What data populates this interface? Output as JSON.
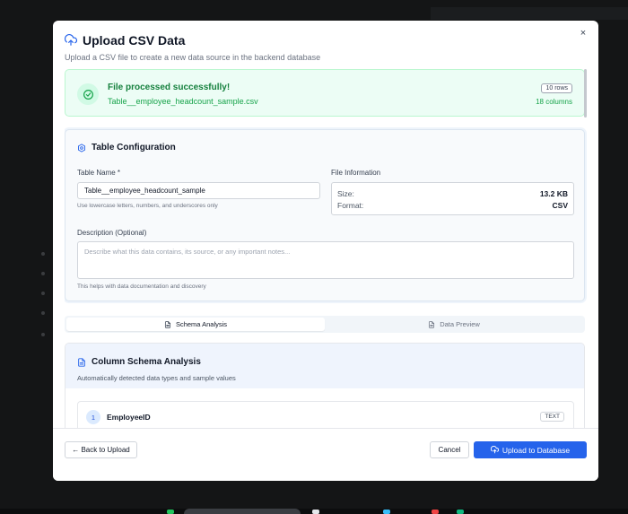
{
  "modal": {
    "title": "Upload CSV Data",
    "subtitle": "Upload a CSV file to create a new data source in the backend database",
    "close_label": "×"
  },
  "success": {
    "title": "File processed successfully!",
    "file_name": "Table__employee_headcount_sample.csv",
    "rows_badge": "10 rows",
    "columns_text": "18 columns"
  },
  "config": {
    "title": "Table Configuration",
    "table_name_label": "Table Name *",
    "table_name_value": "Table__employee_headcount_sample",
    "table_name_hint": "Use lowercase letters, numbers, and underscores only",
    "file_info_label": "File Information",
    "size_label": "Size:",
    "size_value": "13.2 KB",
    "format_label": "Format:",
    "format_value": "CSV",
    "description_label": "Description (Optional)",
    "description_placeholder": "Describe what this data contains, its source, or any important notes...",
    "description_hint": "This helps with data documentation and discovery"
  },
  "tabs": [
    {
      "label": "Schema Analysis",
      "active": true
    },
    {
      "label": "Data Preview",
      "active": false
    }
  ],
  "schema": {
    "title": "Column Schema Analysis",
    "subtitle": "Automatically detected data types and sample values",
    "columns": [
      {
        "index": "1",
        "name": "EmployeeID",
        "type": "TEXT"
      }
    ]
  },
  "footer": {
    "back_label": "← Back to Upload",
    "cancel_label": "Cancel",
    "upload_label": "Upload to Database"
  },
  "colors": {
    "primary": "#2563eb",
    "success_bg": "#ecfdf5",
    "success_text": "#15803d"
  }
}
